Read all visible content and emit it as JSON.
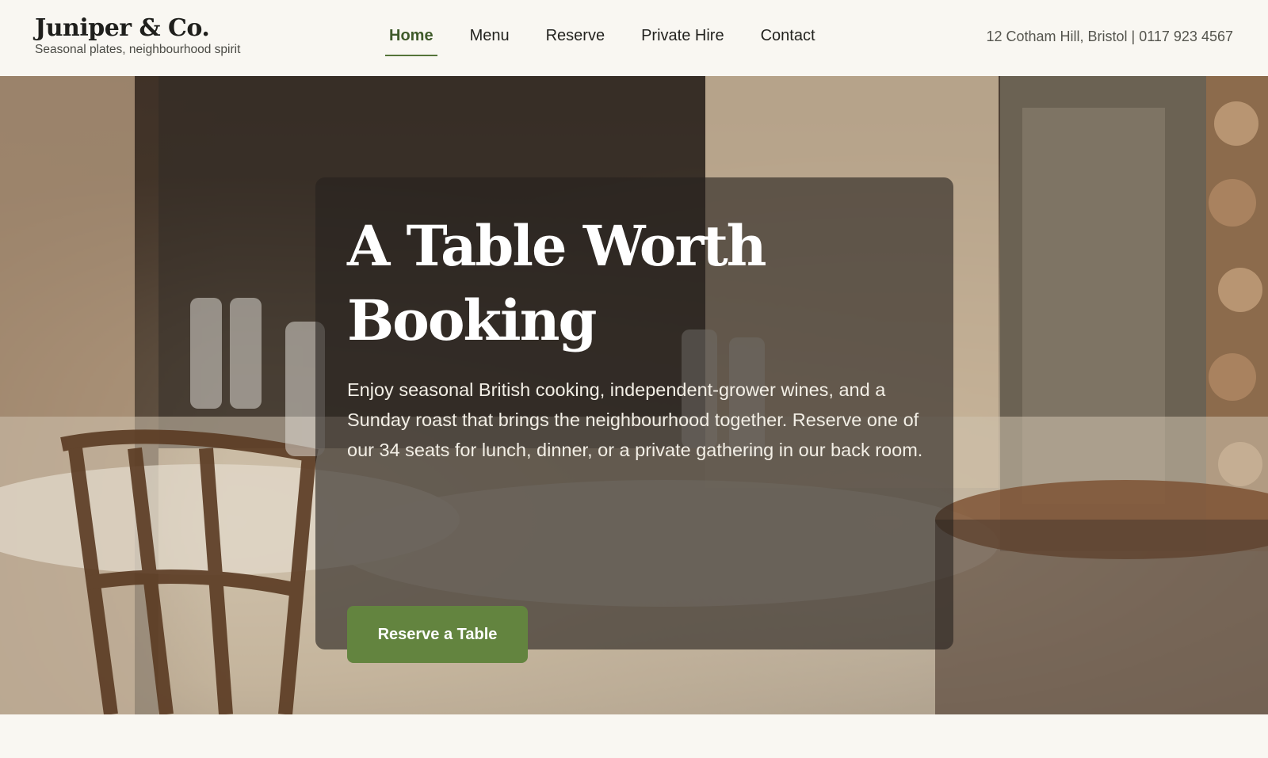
{
  "brand": {
    "name": "Juniper & Co.",
    "tagline": "Seasonal plates, neighbourhood spirit"
  },
  "nav": {
    "items": [
      {
        "label": "Home",
        "active": true
      },
      {
        "label": "Menu",
        "active": false
      },
      {
        "label": "Reserve",
        "active": false
      },
      {
        "label": "Private Hire",
        "active": false
      },
      {
        "label": "Contact",
        "active": false
      }
    ]
  },
  "contact": {
    "line": "12 Cotham Hill, Bristol | 0117 923 4567"
  },
  "hero": {
    "title": "A Table Worth Booking",
    "body": "Enjoy seasonal British cooking, independent-grower wines, and a Sunday roast that brings the neighbourhood together. Reserve one of our 34 seats for lunch, dinner, or a private gathering in our back room.",
    "cta_label": "Reserve a Table",
    "image_description": "Restaurant dining room with set tables, wooden chairs and glassware"
  },
  "colors": {
    "accent": "#63843f",
    "nav_active": "#3f5a2a",
    "background": "#f9f7f2"
  }
}
